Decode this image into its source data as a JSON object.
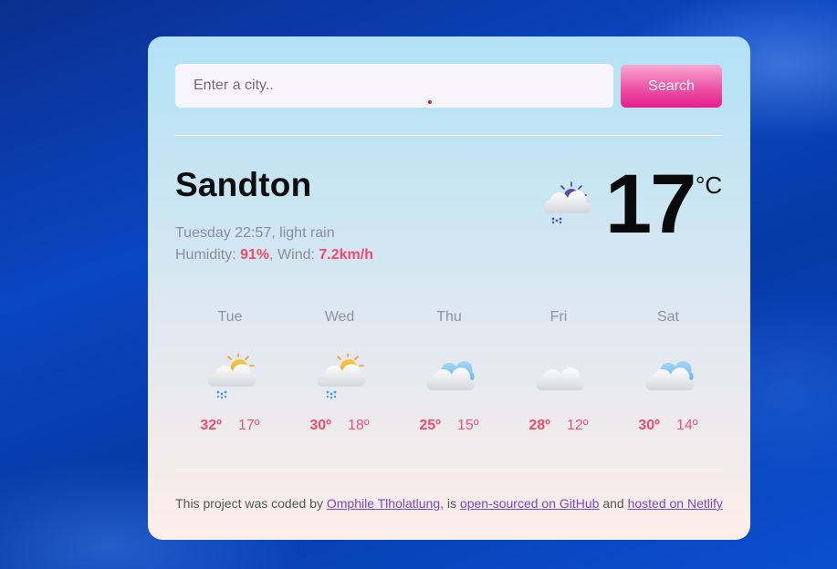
{
  "search": {
    "placeholder": "Enter a city..",
    "button_label": "Search"
  },
  "current": {
    "city": "Sandton",
    "datetime": "Tuesday 22:57",
    "sep_desc": ", ",
    "description": "light rain",
    "humidity_label": "Humidity: ",
    "humidity": "91%",
    "sep_wind": ", ",
    "wind_label": "Wind: ",
    "wind": "7.2km/h",
    "temperature": "17",
    "unit": "°C",
    "icon": "night-rain-icon"
  },
  "forecast": [
    {
      "day": "Tue",
      "max": "32º",
      "min": "17º",
      "icon": "sun-cloud-rain-icon"
    },
    {
      "day": "Wed",
      "max": "30º",
      "min": "18º",
      "icon": "sun-cloud-rain-icon"
    },
    {
      "day": "Thu",
      "max": "25º",
      "min": "15º",
      "icon": "blue-cloud-icon"
    },
    {
      "day": "Fri",
      "max": "28º",
      "min": "12º",
      "icon": "cloud-icon"
    },
    {
      "day": "Sat",
      "max": "30º",
      "min": "14º",
      "icon": "blue-cloud-icon"
    }
  ],
  "footer": {
    "text1": "This project was coded by ",
    "author": "Omphile Tlholatlung",
    "text2": ", is ",
    "github": "open-sourced on GitHub",
    "text3": " and ",
    "netlify": "hosted on Netlify"
  },
  "colors": {
    "accent": "#e41e8c",
    "highlight": "#f24a6f",
    "link": "#7a48c4"
  }
}
